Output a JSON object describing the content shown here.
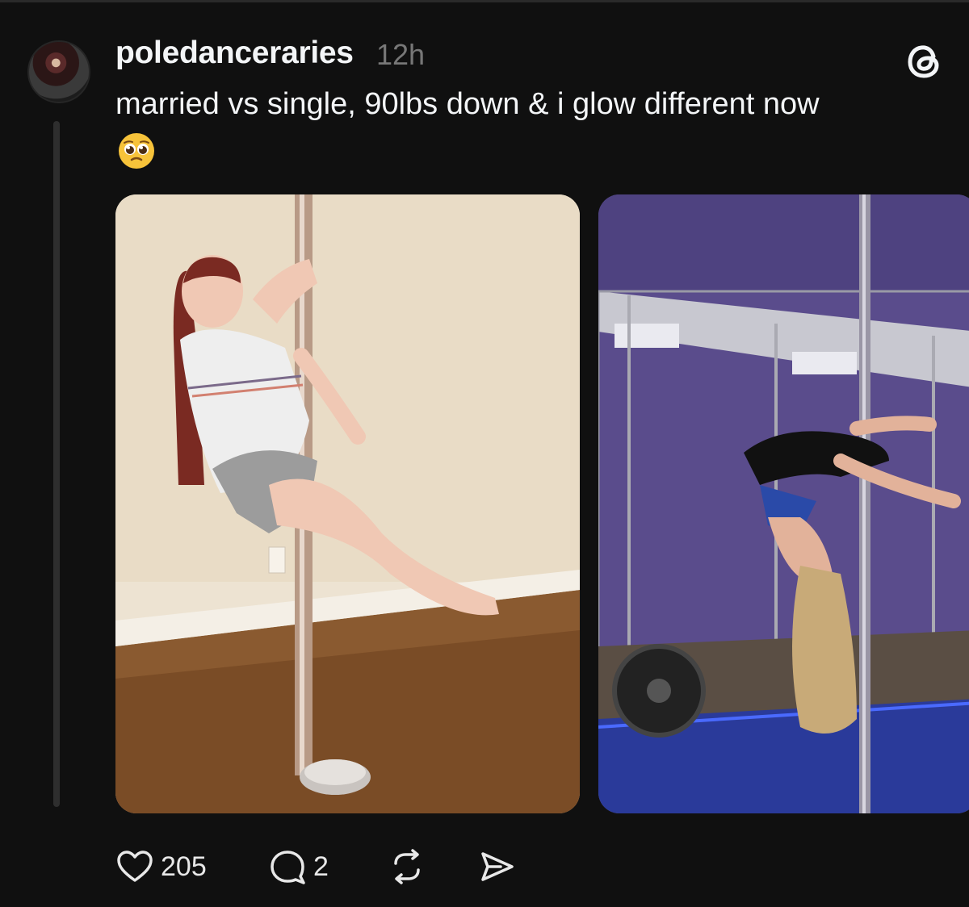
{
  "post": {
    "username": "poledanceraries",
    "timestamp": "12h",
    "caption": "married vs single, 90lbs down & i glow different now",
    "emoji": "pleading-face-emoji",
    "images": [
      {
        "name": "before-photo"
      },
      {
        "name": "after-photo"
      }
    ]
  },
  "actions": {
    "likes": "205",
    "replies": "2"
  },
  "colors": {
    "background": "#101010",
    "text": "#f3f5f7",
    "muted": "#777777"
  },
  "icons": [
    "threads-logo-icon",
    "heart-icon",
    "comment-icon",
    "repost-icon",
    "share-icon"
  ]
}
